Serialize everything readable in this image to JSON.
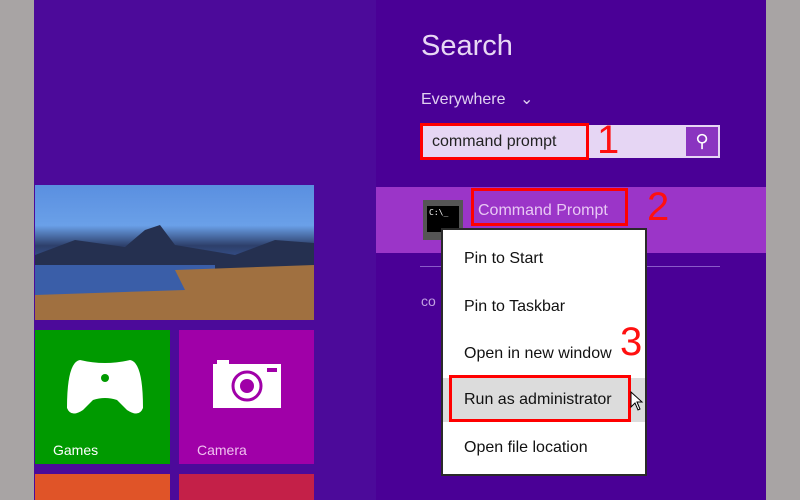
{
  "start": {
    "tiles": [
      {
        "label": "Games",
        "icon": "game-controller-icon",
        "color": "#009a00"
      },
      {
        "label": "Camera",
        "icon": "camera-icon",
        "color": "#a000a8"
      }
    ]
  },
  "search": {
    "title": "Search",
    "scope": "Everywhere",
    "query": "command prompt",
    "results": [
      {
        "label": "Command Prompt",
        "icon": "command-prompt-icon"
      }
    ],
    "section_partial": "co"
  },
  "context_menu": {
    "items": [
      "Pin to Start",
      "Pin to Taskbar",
      "Open in new window",
      "Run as administrator",
      "Open file location"
    ]
  },
  "annotations": {
    "step1": "1",
    "step2": "2",
    "step3": "3"
  },
  "colors": {
    "accent": "#4a0096",
    "highlight": "#9b35c8",
    "annotation": "#ff0000"
  }
}
